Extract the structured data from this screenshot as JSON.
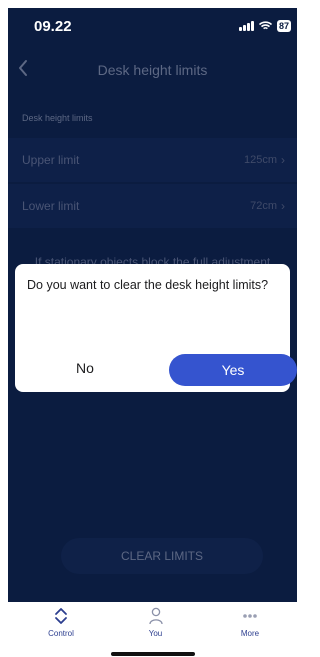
{
  "status_bar": {
    "time": "09.22",
    "battery": "87"
  },
  "header": {
    "title": "Desk height limits"
  },
  "section": {
    "label": "Desk height limits"
  },
  "rows": [
    {
      "label": "Upper limit",
      "value": "125cm"
    },
    {
      "label": "Lower limit",
      "value": "72cm"
    }
  ],
  "info_text": "If stationary objects block the full adjustment",
  "dialog": {
    "message": "Do you want to clear the desk height limits?",
    "no_label": "No",
    "yes_label": "Yes"
  },
  "clear_button": {
    "label": "CLEAR LIMITS"
  },
  "tabs": [
    {
      "label": "Control",
      "icon": "up-down-chevron-icon"
    },
    {
      "label": "You",
      "icon": "person-icon"
    },
    {
      "label": "More",
      "icon": "more-dots-icon"
    }
  ],
  "colors": {
    "background": "#0b1c40",
    "accent": "#3554cf",
    "tab_text": "#2c3e8f"
  }
}
